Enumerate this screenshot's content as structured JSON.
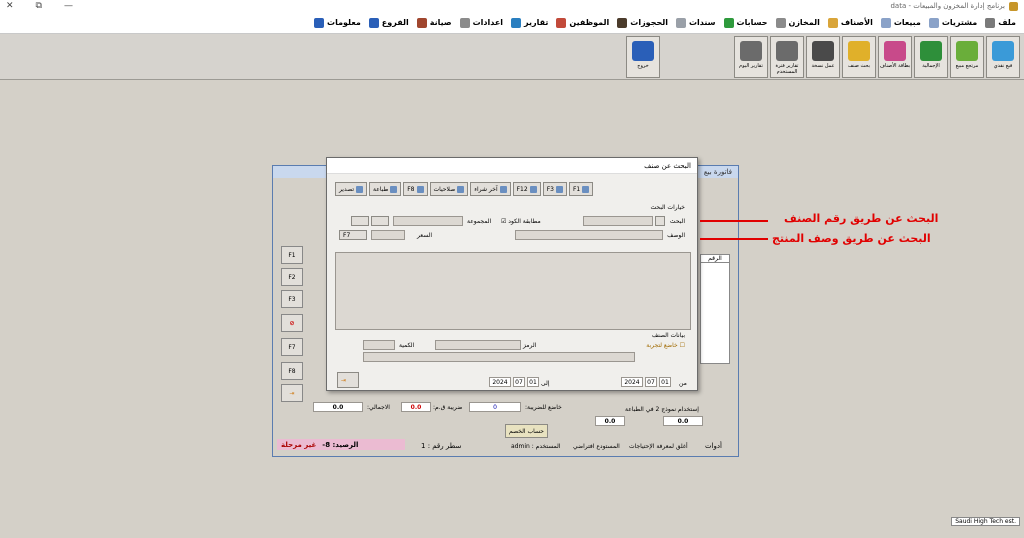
{
  "window": {
    "title": "برنامج إدارة المخزون والمبيعات - data",
    "controls": [
      "✕",
      "⧉",
      "—"
    ]
  },
  "menu": [
    {
      "label": "ملف",
      "icon": "file-icon",
      "color": "#7a7a7a"
    },
    {
      "label": "مشتريات",
      "icon": "purchases-icon",
      "color": "#8aa2c8"
    },
    {
      "label": "مبيعات",
      "icon": "sales-icon",
      "color": "#8aa2c8"
    },
    {
      "label": "الأصناف",
      "icon": "items-icon",
      "color": "#d9a53a"
    },
    {
      "label": "المخازن",
      "icon": "stores-icon",
      "color": "#8b8b8b"
    },
    {
      "label": "حسابات",
      "icon": "accounts-icon",
      "color": "#2e9a3c"
    },
    {
      "label": "سندات",
      "icon": "vouchers-icon",
      "color": "#9aa0a8"
    },
    {
      "label": "الحجوزات",
      "icon": "reservations-icon",
      "color": "#4b3b2b"
    },
    {
      "label": "الموظفين",
      "icon": "employees-icon",
      "color": "#c24a3a"
    },
    {
      "label": "تقارير",
      "icon": "reports-icon",
      "color": "#2a7fc0"
    },
    {
      "label": "اعدادات",
      "icon": "settings-icon",
      "color": "#8b8b8b"
    },
    {
      "label": "صيانة",
      "icon": "maintenance-icon",
      "color": "#a0462e"
    },
    {
      "label": "الفروع",
      "icon": "branches-icon",
      "color": "#2a5fb8"
    },
    {
      "label": "معلومات",
      "icon": "info-icon",
      "color": "#2a5fb8"
    }
  ],
  "toolbar": [
    {
      "label": "فيع نقدي",
      "icon": "cash-sale-icon",
      "color": "#3a9ad8"
    },
    {
      "label": "مرتجع مبيع",
      "icon": "sale-return-icon",
      "color": "#6aae3a"
    },
    {
      "label": "الإجمالية",
      "icon": "totals-icon",
      "color": "#2e8f3a"
    },
    {
      "label": "بطاقة الأصناف",
      "icon": "item-card-icon",
      "color": "#c84a8a"
    },
    {
      "label": "بحث صنف",
      "icon": "search-item-icon",
      "color": "#e0b02a"
    },
    {
      "label": "عمل نسخة",
      "icon": "backup-icon",
      "color": "#4a4a4a"
    },
    {
      "label": "تقارير فترة المستخدم",
      "icon": "user-report-icon",
      "color": "#6b6b6b"
    },
    {
      "label": "تقارير اليوم",
      "icon": "daily-report-icon",
      "color": "#6b6b6b"
    },
    {
      "label": "خروج",
      "icon": "exit-icon",
      "color": "#2a5fb8"
    }
  ],
  "invoice_window": {
    "title": "فاتورة بيع",
    "side_buttons": [
      "F1",
      "F2",
      "F3",
      "F7",
      "F8"
    ],
    "grid_header": "الرقم",
    "total_label": "الاجمالي:",
    "total_value": "0.0",
    "tax_label": "ضريبة ق.م:",
    "tax_value": "0.0",
    "taxable_label": "خاضع للضريبة:",
    "taxable_value": "0",
    "discount_label": "الخصم",
    "discount_value": "0.0",
    "qty_value": "0.0",
    "print_model_label": "إستخدام نموذج 2 في الطباعة",
    "discount_calc_btn": "حساب الخصم",
    "balance_label": "الرصيد: 8-",
    "unposted_label": "غير مرحلة",
    "row_number_label": "سطر رقم : 1",
    "user_label": "المستخدم : admin",
    "level_label": "المستودع افتراضي",
    "account_label": "أغلق لمعرفة الإحتياجات",
    "tools_label": "أدوات"
  },
  "dialog": {
    "title": "البحث عن صنف",
    "buttons": [
      {
        "label": "F1",
        "icon": "new-icon"
      },
      {
        "label": "F3",
        "icon": "list-icon"
      },
      {
        "label": "F12",
        "icon": "exit-icon"
      },
      {
        "label": "آخر شراء",
        "icon": "diamond-icon"
      },
      {
        "label": "صلاحيات",
        "icon": "permissions-icon"
      },
      {
        "label": "F8",
        "icon": "print-icon"
      },
      {
        "label": "طباعة",
        "icon": "print2-icon"
      },
      {
        "label": "تصدير",
        "icon": "export-icon"
      }
    ],
    "search_options_label": "خيارات البحث",
    "search_label": "البحث",
    "match_code_label": "مطابقة الكود",
    "group_label": "المجموعة",
    "description_label": "الوصف",
    "price_label": "السعر",
    "f7_label": "F7",
    "item_data_label": "بيانات الصنف",
    "trial_label": "خاضع لتجربة",
    "symbol_label": "الرمز",
    "qty_label": "الكمية",
    "from_label": "من",
    "to_label": "إلى",
    "from_date": {
      "year": "2024",
      "month": "07",
      "day": "01"
    },
    "to_date": {
      "year": "2024",
      "month": "07",
      "day": "01"
    }
  },
  "annotations": {
    "line1": "البحث عن طريق رقم الصنف",
    "line2": "البحث عن طريق وصف المنتج",
    "color": "#e10000"
  },
  "brand": "Saudi High Tech est."
}
